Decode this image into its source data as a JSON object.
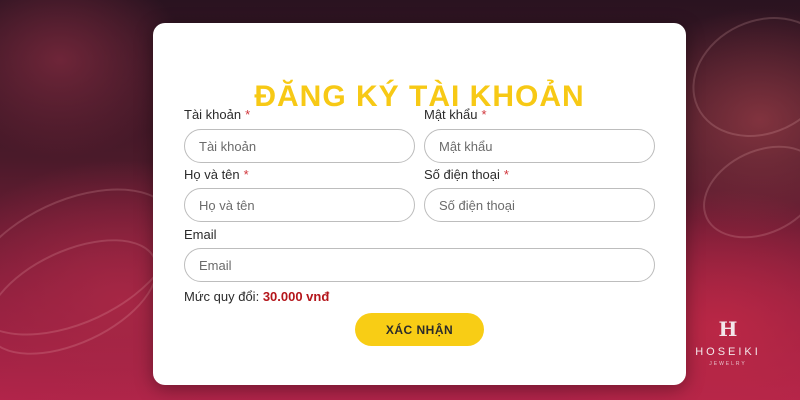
{
  "form": {
    "title": "ĐĂNG KÝ TÀI KHOẢN",
    "fields": {
      "account": {
        "label": "Tài khoản",
        "required_mark": "*",
        "placeholder": "Tài khoản",
        "value": ""
      },
      "password": {
        "label": "Mật khẩu",
        "required_mark": "*",
        "placeholder": "Mật khẩu",
        "value": ""
      },
      "fullname": {
        "label": "Họ và tên",
        "required_mark": "*",
        "placeholder": "Họ và tên",
        "value": ""
      },
      "phone": {
        "label": "Số điện thoại",
        "required_mark": "*",
        "placeholder": "Số điện thoại",
        "value": ""
      },
      "email": {
        "label": "Email",
        "placeholder": "Email",
        "value": ""
      }
    },
    "exchange_rate": {
      "label": "Mức quy đổi:",
      "value": "30.000 vnđ"
    },
    "submit_label": "XÁC NHẬN"
  },
  "brand": {
    "name": "HOSEIKI",
    "tagline": "JEWELRY",
    "mark": "H"
  },
  "colors": {
    "title": "#f7c915",
    "button": "#f8cd15",
    "required": "#d0343a",
    "rate_value": "#b4161b"
  }
}
